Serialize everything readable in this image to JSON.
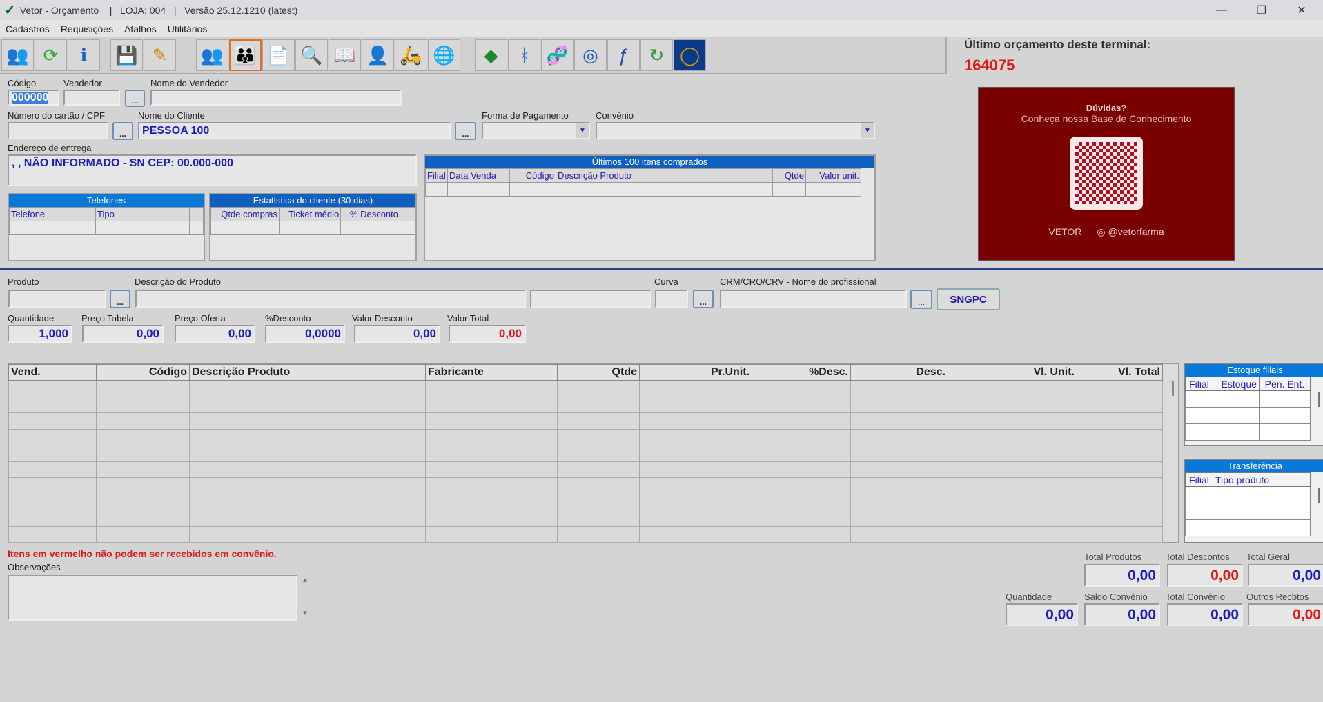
{
  "window": {
    "title": "Vetor - Orçamento    |   LOJA: 004   |   Versão 25.12.1210 (latest)",
    "minimize": "—",
    "restore": "❐",
    "close": "✕"
  },
  "menu": [
    "Cadastros",
    "Requisições",
    "Atalhos",
    "Utilitários"
  ],
  "toolbar": [
    {
      "icon": "add-user-icon",
      "glyph": "👥"
    },
    {
      "icon": "refresh-icon",
      "glyph": "⟳"
    },
    {
      "icon": "info-icon",
      "glyph": "ℹ"
    },
    {
      "icon": "save-icon",
      "glyph": "💾"
    },
    {
      "icon": "edit-icon",
      "glyph": "✎"
    },
    {
      "icon": "users-icon",
      "glyph": "👥"
    },
    {
      "icon": "users-selected-icon",
      "glyph": "👪"
    },
    {
      "icon": "documents-icon",
      "glyph": "📄"
    },
    {
      "icon": "search-icon",
      "glyph": "🔍"
    },
    {
      "icon": "book-icon",
      "glyph": "📖"
    },
    {
      "icon": "person-icon",
      "glyph": "👤"
    },
    {
      "icon": "delivery-icon",
      "glyph": "🛵"
    },
    {
      "icon": "globe-icon",
      "glyph": "🌐"
    },
    {
      "icon": "brazil-flag-icon",
      "glyph": "◆"
    },
    {
      "icon": "figure-icon",
      "glyph": "ᚼ"
    },
    {
      "icon": "dna-icon",
      "glyph": "🧬"
    },
    {
      "icon": "spiral-icon",
      "glyph": "◎"
    },
    {
      "icon": "f-logo-icon",
      "glyph": "ƒ"
    },
    {
      "icon": "cycle-icon",
      "glyph": "↻"
    },
    {
      "icon": "ring-icon",
      "glyph": "◯"
    }
  ],
  "last_quote": {
    "label": "Último orçamento deste terminal:",
    "value": "164075"
  },
  "banner": {
    "title": "Dúvidas?",
    "subtitle": "Conheça nossa Base de Conhecimento",
    "brand": "VETOR",
    "instagram": "@vetorfarma"
  },
  "header": {
    "codigo": {
      "label": "Código",
      "value": "000000"
    },
    "vendedor": {
      "label": "Vendedor",
      "value": ""
    },
    "nome_vendedor": {
      "label": "Nome do Vendedor",
      "value": ""
    },
    "cartao": {
      "label": "Número do cartão / CPF",
      "value": ""
    },
    "cliente": {
      "label": "Nome do Cliente",
      "value": "PESSOA 100"
    },
    "pagamento": {
      "label": "Forma de Pagamento",
      "value": ""
    },
    "convenio": {
      "label": "Convênio",
      "value": ""
    },
    "endereco": {
      "label": "Endereço de entrega",
      "value": ", , NÃO INFORMADO - SN CEP: 00.000-000"
    },
    "ellipsis": "..."
  },
  "telefones": {
    "title": "Telefones",
    "columns": [
      "Telefone",
      "Tipo"
    ]
  },
  "estatistica": {
    "title": "Estatística do cliente (30 dias)",
    "columns": [
      "Qtde compras",
      "Ticket médio",
      "% Desconto"
    ]
  },
  "ultimos": {
    "title": "Últimos 100 itens comprados",
    "columns": [
      "Filial",
      "Data Venda",
      "Código",
      "Descrição Produto",
      "Qtde",
      "Valor unit."
    ]
  },
  "produto": {
    "produto_label": "Produto",
    "descricao_label": "Descrição do Produto",
    "curva_label": "Curva",
    "crm_label": "CRM/CRO/CRV - Nome do profissional",
    "sngpc": "SNGPC",
    "quantidade": {
      "label": "Quantidade",
      "value": "1,000"
    },
    "preco_tabela": {
      "label": "Preço Tabela",
      "value": "0,00"
    },
    "preco_oferta": {
      "label": "Preço Oferta",
      "value": "0,00"
    },
    "desconto_pct": {
      "label": "%Desconto",
      "value": "0,0000"
    },
    "valor_desconto": {
      "label": "Valor Desconto",
      "value": "0,00"
    },
    "valor_total": {
      "label": "Valor Total",
      "value": "0,00"
    }
  },
  "grid": {
    "columns": [
      "Vend.",
      "Código",
      "Descrição Produto",
      "Fabricante",
      "Qtde",
      "Pr.Unit.",
      "%Desc.",
      "Desc.",
      "Vl. Unit.",
      "Vl. Total"
    ]
  },
  "estoque": {
    "title": "Estoque filiais",
    "columns": [
      "Filial",
      "Estoque",
      "Pen. Ent."
    ]
  },
  "transferencia": {
    "title": "Transferência",
    "columns": [
      "Filial",
      "Tipo produto"
    ]
  },
  "warning": "Itens em vermelho não podem ser recebidos em convênio.",
  "observacoes": {
    "label": "Observações",
    "value": ""
  },
  "totals": {
    "total_produtos": {
      "label": "Total Produtos",
      "value": "0,00"
    },
    "total_descontos": {
      "label": "Total Descontos",
      "value": "0,00"
    },
    "total_geral": {
      "label": "Total Geral",
      "value": "0,00"
    },
    "quantidade": {
      "label": "Quantidade",
      "value": "0,00"
    },
    "saldo_convenio": {
      "label": "Saldo Convênio",
      "value": "0,00"
    },
    "total_convenio": {
      "label": "Total Convênio",
      "value": "0,00"
    },
    "outros_recebtos": {
      "label": "Outros Recbtos",
      "value": "0,00"
    }
  }
}
